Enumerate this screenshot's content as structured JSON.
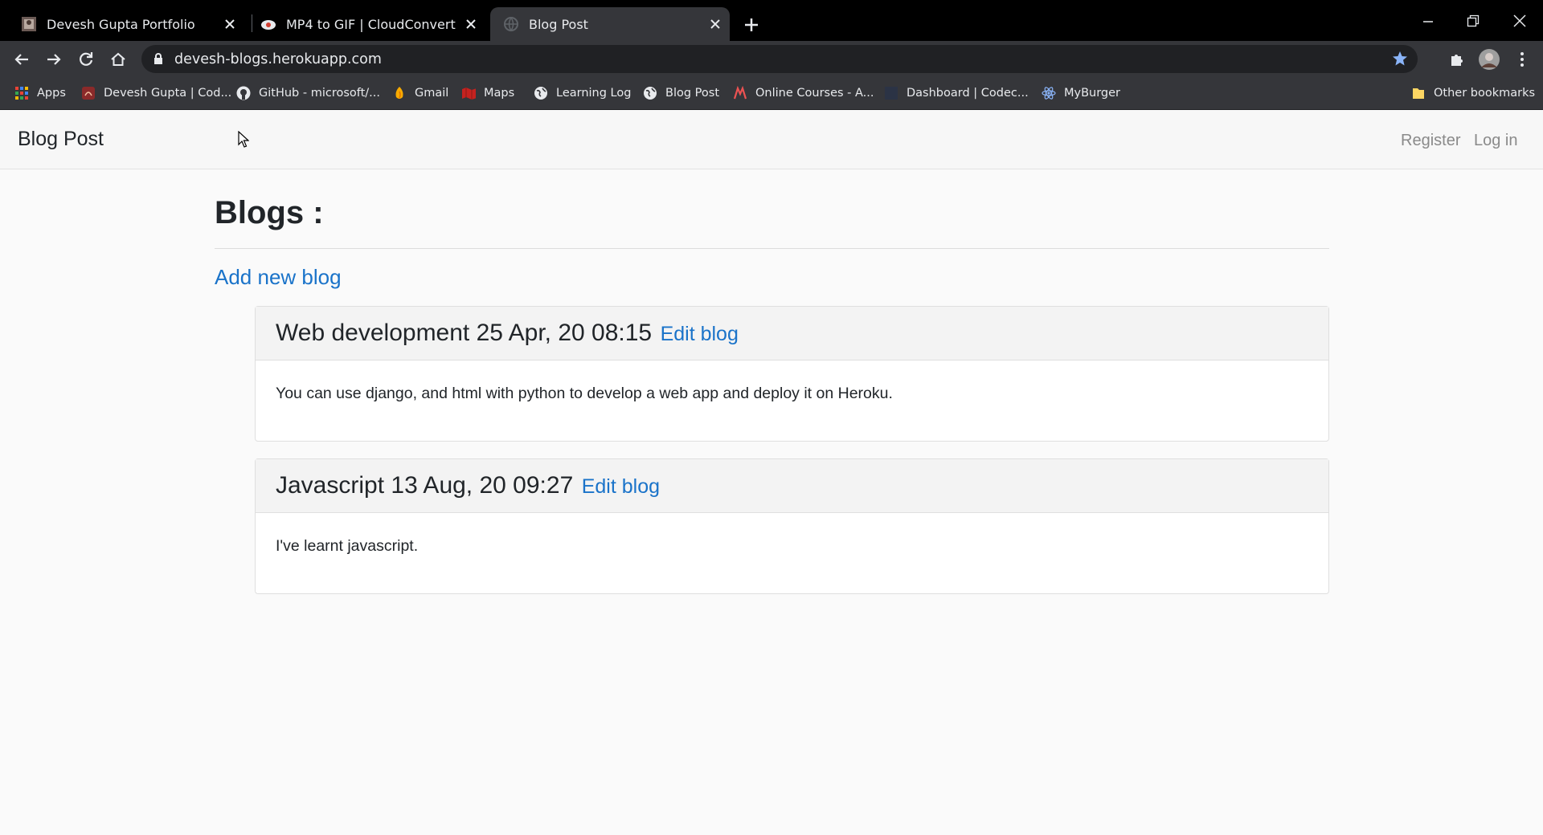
{
  "browser": {
    "tabs": [
      {
        "title": "Devesh Gupta Portfolio",
        "icon": "portfolio-icon",
        "active": false
      },
      {
        "title": "MP4 to GIF | CloudConvert",
        "icon": "cloudconvert-icon",
        "active": false
      },
      {
        "title": "Blog Post",
        "icon": "globe-icon",
        "active": true
      }
    ],
    "url": "devesh-blogs.herokuapp.com",
    "bookmarks": [
      {
        "label": "Apps",
        "icon": "apps-grid-icon"
      },
      {
        "label": "Devesh Gupta | Cod...",
        "icon": "codechef-icon"
      },
      {
        "label": "GitHub - microsoft/...",
        "icon": "github-icon"
      },
      {
        "label": "Gmail",
        "icon": "gmail-icon"
      },
      {
        "label": "Maps",
        "icon": "maps-icon"
      },
      {
        "label": "Learning Log",
        "icon": "globe-icon"
      },
      {
        "label": "Blog Post",
        "icon": "globe-icon"
      },
      {
        "label": "Online Courses - A...",
        "icon": "udemy-icon"
      },
      {
        "label": "Dashboard | Codec...",
        "icon": "codecademy-icon"
      },
      {
        "label": "MyBurger",
        "icon": "react-icon"
      }
    ],
    "other_bookmarks": "Other bookmarks",
    "colors": {
      "tabstrip": "#000000",
      "toolbar": "#35363a",
      "star": "#8ab4f8"
    }
  },
  "navbar": {
    "brand": "Blog Post",
    "register": "Register",
    "login": "Log in"
  },
  "main": {
    "heading": "Blogs :",
    "add_link": "Add new blog",
    "posts": [
      {
        "title": "Web development 25 Apr, 20 08:15",
        "edit": "Edit blog",
        "body": "You can use django, and html with python to develop a web app and deploy it on Heroku."
      },
      {
        "title": "Javascript 13 Aug, 20 09:27",
        "edit": "Edit blog",
        "body": "I've learnt javascript."
      }
    ]
  },
  "colors": {
    "link": "#1a73c9",
    "text": "#212529",
    "navbar_bg": "#f7f7f7"
  }
}
